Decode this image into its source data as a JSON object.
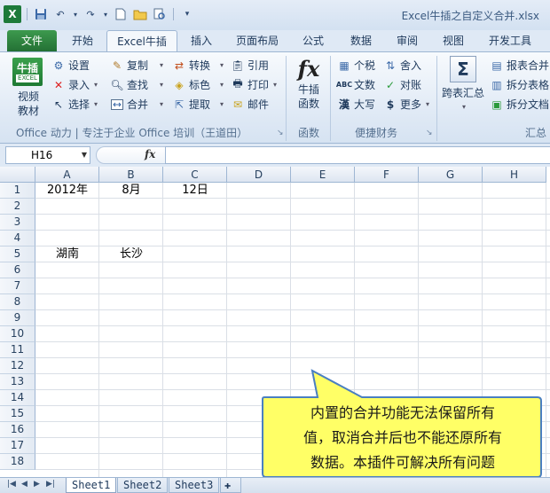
{
  "window": {
    "title": "Excel牛插之自定义合并.xlsx",
    "app_icon": "X"
  },
  "tabs": [
    "文件",
    "开始",
    "Excel牛插",
    "插入",
    "页面布局",
    "公式",
    "数据",
    "审阅",
    "视图",
    "开发工具"
  ],
  "ribbon": {
    "logo_top": "牛插",
    "logo_bottom": "EXCEL",
    "video_line1": "视频",
    "video_line2": "教材",
    "settings": "设置",
    "entry": "录入",
    "select": "选择",
    "copy": "复制",
    "find": "查找",
    "merge": "合并",
    "convert": "转换",
    "mark": "标色",
    "extract": "提取",
    "reference": "引用",
    "print": "打印",
    "mail": "邮件",
    "niuchao_func_line1": "牛插",
    "niuchao_func_line2": "函数",
    "tax": "个税",
    "text": "文数",
    "chinese_upper": "大写",
    "round": "舍入",
    "check": "对账",
    "more": "更多",
    "cross_table_sum": "跨表汇总",
    "report_merge": "报表合并",
    "split_table": "拆分表格",
    "split_doc": "拆分文档",
    "group1_label": "Office 动力 | 专注于企业 Office 培训（王道田）",
    "group2_label": "函数",
    "group3_label": "便捷财务",
    "group4_label": "汇总"
  },
  "formula_bar": {
    "name_box": "H16",
    "fx": "fx",
    "content": ""
  },
  "grid": {
    "columns": [
      "A",
      "B",
      "C",
      "D",
      "E",
      "F",
      "G",
      "H"
    ],
    "rows": [
      "1",
      "2",
      "3",
      "4",
      "5",
      "6",
      "7",
      "8",
      "9",
      "10",
      "11",
      "12",
      "13",
      "14",
      "15",
      "16",
      "17",
      "18"
    ],
    "cells": {
      "A1": "2012年",
      "B1": "8月",
      "C1": "12日",
      "A5": "湖南",
      "B5": "长沙"
    }
  },
  "callout": {
    "line1": "内置的合并功能无法保留所有",
    "line2": "值，取消合并后也不能还原所有",
    "line3": "数据。本插件可解决所有问题"
  },
  "sheets": [
    "Sheet1",
    "Sheet2",
    "Sheet3"
  ],
  "colors": {
    "callout_fill": "#ffff66",
    "callout_border": "#4a7fc1",
    "file_tab": "#2e8540"
  }
}
